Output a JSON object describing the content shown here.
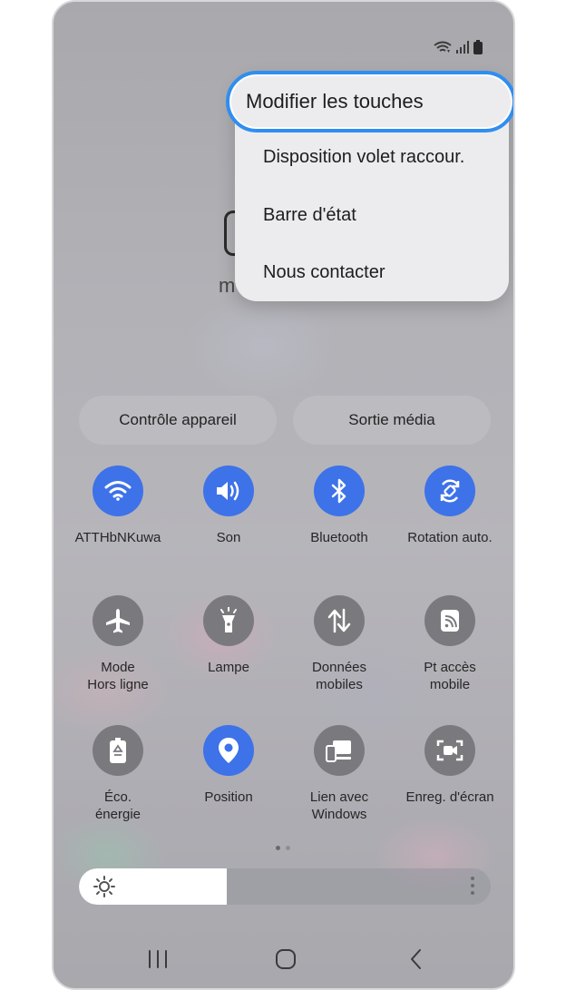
{
  "menu": {
    "items": [
      {
        "label": "Modifier les touches"
      },
      {
        "label": "Disposition volet raccour."
      },
      {
        "label": "Barre d'état"
      },
      {
        "label": "Nous contacter"
      }
    ],
    "highlight_color": "#2f8ef0"
  },
  "background_text": {
    "fragment": "m"
  },
  "panel_buttons": {
    "device_control": "Contrôle appareil",
    "media_output": "Sortie média"
  },
  "tiles": [
    {
      "label": "ATTHbNKuwa",
      "icon": "wifi-icon",
      "active": true
    },
    {
      "label": "Son",
      "icon": "sound-icon",
      "active": true
    },
    {
      "label": "Bluetooth",
      "icon": "bluetooth-icon",
      "active": true
    },
    {
      "label": "Rotation auto.",
      "icon": "rotation-icon",
      "active": true
    },
    {
      "label": "Mode\nHors ligne",
      "icon": "airplane-icon",
      "active": false
    },
    {
      "label": "Lampe",
      "icon": "flashlight-icon",
      "active": false
    },
    {
      "label": "Données\nmobiles",
      "icon": "mobile-data-icon",
      "active": false
    },
    {
      "label": "Pt accès\nmobile",
      "icon": "hotspot-icon",
      "active": false
    },
    {
      "label": "Éco.\nénergie",
      "icon": "power-saving-icon",
      "active": false
    },
    {
      "label": "Position",
      "icon": "location-icon",
      "active": true
    },
    {
      "label": "Lien avec\nWindows",
      "icon": "link-windows-icon",
      "active": false
    },
    {
      "label": "Enreg. d'écran",
      "icon": "screen-recorder-icon",
      "active": false
    }
  ],
  "brightness": {
    "level": 0.36
  },
  "pager": {
    "pages": 2,
    "current": 1
  },
  "colors": {
    "accent": "#3d72e8",
    "inactive": "#7a7a7e"
  }
}
